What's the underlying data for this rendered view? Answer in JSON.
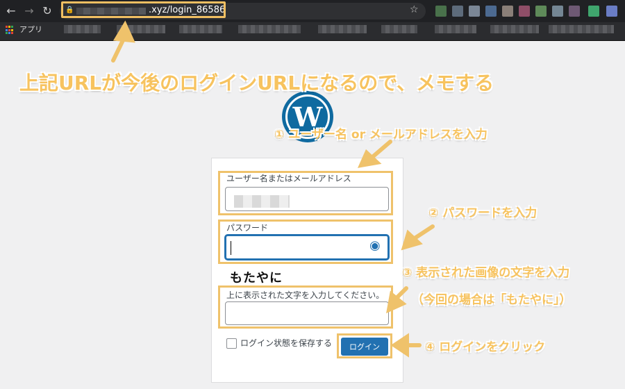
{
  "browser": {
    "url_suffix": ".xyz/login_86586",
    "bookmark_label": "アプリ",
    "icons": {
      "back": "←",
      "forward": "→",
      "reload": "↻",
      "star": "☆",
      "lock": "🔒"
    }
  },
  "login": {
    "logo_letter": "W",
    "username_label": "ユーザー名またはメールアドレス",
    "password_label": "パスワード",
    "captcha_text": "もたやに",
    "captcha_prompt": "上に表示された文字を入力してください。",
    "remember_label": "ログイン状態を保存する",
    "login_button": "ログイン",
    "eye_icon": "◉"
  },
  "annotations": {
    "url_note": "上記URLが今後のログインURLになるので、メモする",
    "step1": "① ユーザー名 or メールアドレスを入力",
    "step2": "② パスワードを入力",
    "step3": "③ 表示された画像の文字を入力",
    "step3_sub": "（今回の場合は「もたやに」）",
    "step4": "④ ログインをクリック"
  },
  "colors": {
    "accent": "#f0bf62",
    "button": "#2271b1",
    "chrome": "#202124"
  }
}
